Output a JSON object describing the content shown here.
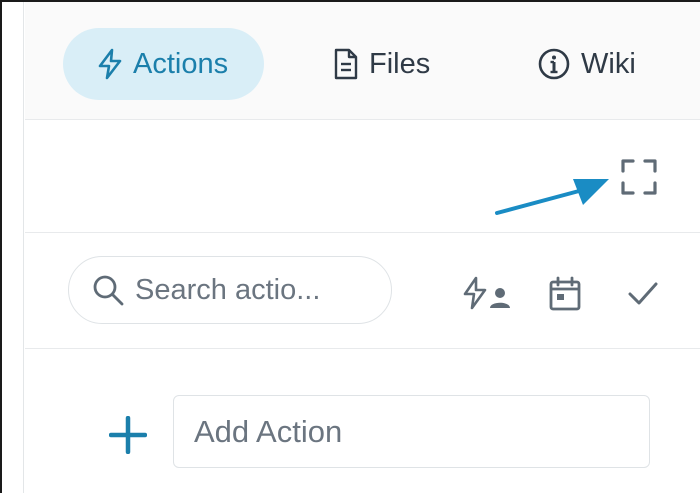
{
  "tabs": [
    {
      "label": "Actions",
      "icon": "lightning-icon",
      "active": true
    },
    {
      "label": "Files",
      "icon": "document-icon",
      "active": false
    },
    {
      "label": "Wiki",
      "icon": "info-circle-icon",
      "active": false
    }
  ],
  "toolbar": {
    "expand_icon": "fullscreen-icon",
    "annotation_icon": "arrow-annotation-icon"
  },
  "search": {
    "placeholder": "Search actio...",
    "value": ""
  },
  "filters": [
    {
      "icon": "assigned-to-me-icon"
    },
    {
      "icon": "calendar-icon"
    },
    {
      "icon": "checkmark-icon"
    }
  ],
  "add_action": {
    "placeholder": "Add Action",
    "value": ""
  },
  "colors": {
    "accent": "#1b7fab",
    "active_tab_bg": "#d9eef7",
    "icon_gray": "#5f6b76",
    "text": "#2f3a46"
  }
}
